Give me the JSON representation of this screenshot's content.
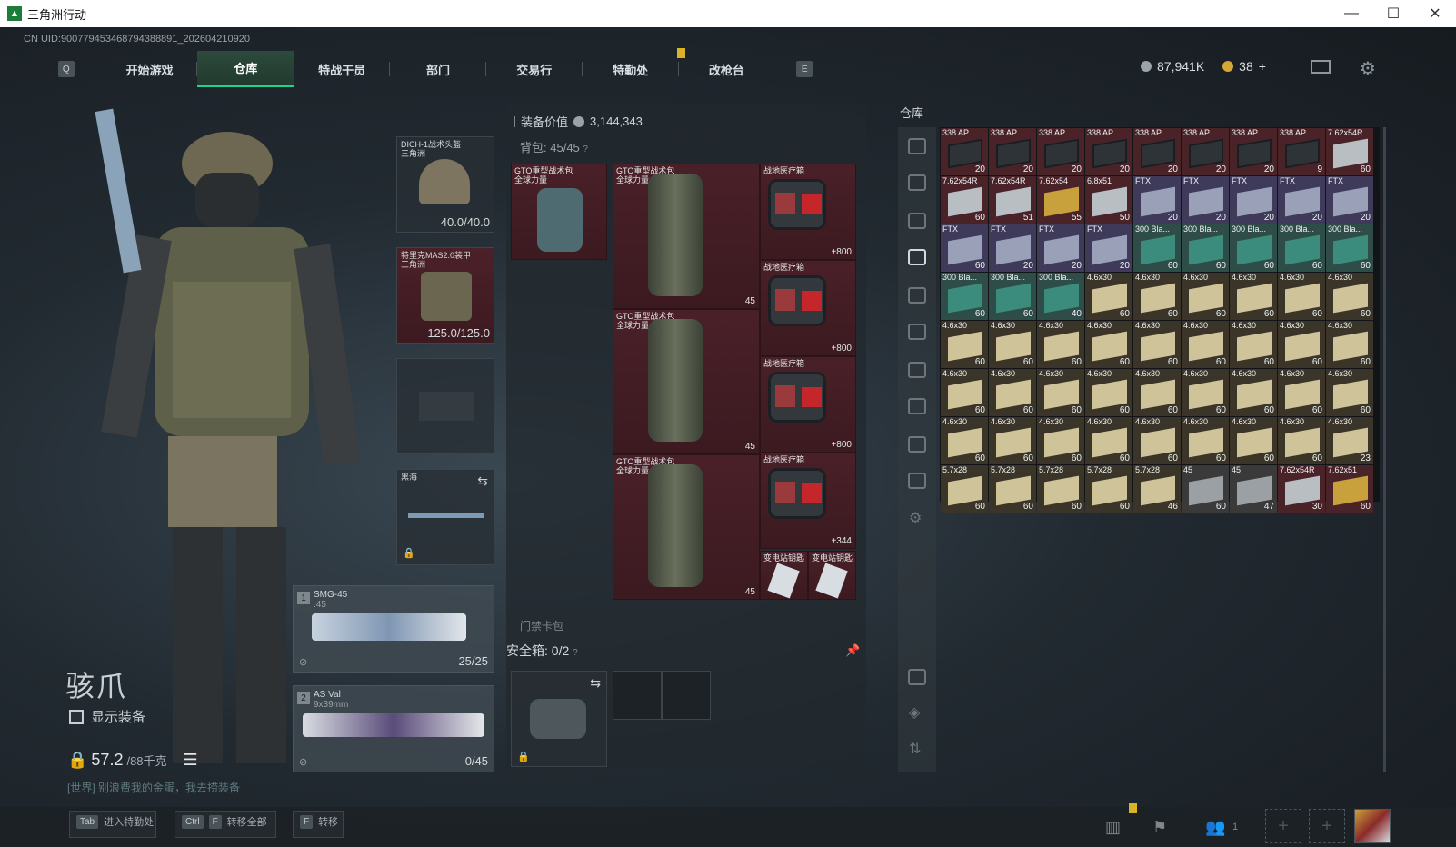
{
  "window": {
    "title": "三角洲行动",
    "minimize": "—",
    "maximize": "☐",
    "close": "✕"
  },
  "uid": "CN UID:900779453468794388891_202604210920",
  "nav": {
    "key_left": "Q",
    "key_right": "E",
    "tabs": [
      "开始游戏",
      "仓库",
      "特战干员",
      "部门",
      "交易行",
      "特勤处",
      "改枪台"
    ],
    "active": "仓库"
  },
  "currency": {
    "primary": "87,941K",
    "secondary": "38",
    "secondary_plus": "+"
  },
  "operator": {
    "name": "骇爪",
    "show_equipment": "显示装备",
    "weight": "57.2",
    "weight_max": "/88千克"
  },
  "chat": "[世界] 别浪费我的金蛋，我去捞装备",
  "slots": {
    "helmet": {
      "name": "DICH-1战术头盔",
      "sub": "三角洲",
      "value": "40.0/40.0"
    },
    "armor": {
      "name": "特里克MAS2.0装甲",
      "sub": "三角洲",
      "value": "125.0/125.0"
    },
    "melee": {
      "name": "黑海"
    }
  },
  "weapons": [
    {
      "index": "1",
      "name": "SMG-45",
      "sub": ".45",
      "ammo": "25/25"
    },
    {
      "index": "2",
      "name": "AS Val",
      "sub": "9x39mm",
      "ammo": "0/45"
    }
  ],
  "middle": {
    "equip_value_label": "装备价值",
    "equip_value": "3,144,343",
    "bag_label": "背包:",
    "bag_value": "45/45",
    "container_label": "门禁卡包",
    "safebox_label": "安全箱:",
    "safebox_value": "0/2",
    "items": [
      {
        "name": "GTO重型战术包",
        "sub": "全球力量"
      },
      {
        "name": "GTO重型战术包",
        "sub": "全球力量",
        "count": "45"
      },
      {
        "name": "GTO重型战术包",
        "sub": "全球力量",
        "count": "45"
      },
      {
        "name": "GTO重型战术包",
        "sub": "全球力量",
        "count": "45"
      },
      {
        "name": "战地医疗箱",
        "count": "+800"
      },
      {
        "name": "战地医疗箱",
        "count": "+800"
      },
      {
        "name": "战地医疗箱",
        "count": "+800"
      },
      {
        "name": "战地医疗箱",
        "count": "+344"
      },
      {
        "name": "变电站钥匙"
      },
      {
        "name": "变电站钥匙"
      }
    ]
  },
  "storage": {
    "title": "仓库",
    "grid": [
      {
        "n": "338 AP",
        "c": "20",
        "t": "338"
      },
      {
        "n": "338 AP",
        "c": "20",
        "t": "338"
      },
      {
        "n": "338 AP",
        "c": "20",
        "t": "338"
      },
      {
        "n": "338 AP",
        "c": "20",
        "t": "338"
      },
      {
        "n": "338 AP",
        "c": "20",
        "t": "338"
      },
      {
        "n": "338 AP",
        "c": "20",
        "t": "338"
      },
      {
        "n": "338 AP",
        "c": "20",
        "t": "338"
      },
      {
        "n": "338 AP",
        "c": "9",
        "t": "338"
      },
      {
        "n": "7.62x54R",
        "c": "60",
        "t": "white"
      },
      {
        "n": "7.62x54R",
        "c": "60",
        "t": "white"
      },
      {
        "n": "7.62x54R",
        "c": "51",
        "t": "white"
      },
      {
        "n": "7.62x54",
        "c": "55",
        "t": "gold"
      },
      {
        "n": "6.8x51",
        "c": "50",
        "t": "white"
      },
      {
        "n": "FTX",
        "c": "20",
        "t": "ftx"
      },
      {
        "n": "FTX",
        "c": "20",
        "t": "ftx"
      },
      {
        "n": "FTX",
        "c": "20",
        "t": "ftx"
      },
      {
        "n": "FTX",
        "c": "20",
        "t": "ftx"
      },
      {
        "n": "FTX",
        "c": "20",
        "t": "ftx"
      },
      {
        "n": "FTX",
        "c": "60",
        "t": "ftx"
      },
      {
        "n": "FTX",
        "c": "20",
        "t": "ftx"
      },
      {
        "n": "FTX",
        "c": "20",
        "t": "ftx"
      },
      {
        "n": "FTX",
        "c": "20",
        "t": "ftx"
      },
      {
        "n": "300 Bla...",
        "c": "60",
        "t": "green"
      },
      {
        "n": "300 Bla...",
        "c": "60",
        "t": "green"
      },
      {
        "n": "300 Bla...",
        "c": "60",
        "t": "green"
      },
      {
        "n": "300 Bla...",
        "c": "60",
        "t": "green"
      },
      {
        "n": "300 Bla...",
        "c": "60",
        "t": "green"
      },
      {
        "n": "300 Bla...",
        "c": "60",
        "t": "green"
      },
      {
        "n": "300 Bla...",
        "c": "60",
        "t": "green"
      },
      {
        "n": "300 Bla...",
        "c": "40",
        "t": "green"
      },
      {
        "n": "4.6x30",
        "c": "60",
        "t": "46"
      },
      {
        "n": "4.6x30",
        "c": "60",
        "t": "46"
      },
      {
        "n": "4.6x30",
        "c": "60",
        "t": "46"
      },
      {
        "n": "4.6x30",
        "c": "60",
        "t": "46"
      },
      {
        "n": "4.6x30",
        "c": "60",
        "t": "46"
      },
      {
        "n": "4.6x30",
        "c": "60",
        "t": "46"
      },
      {
        "n": "4.6x30",
        "c": "60",
        "t": "46"
      },
      {
        "n": "4.6x30",
        "c": "60",
        "t": "46"
      },
      {
        "n": "4.6x30",
        "c": "60",
        "t": "46"
      },
      {
        "n": "4.6x30",
        "c": "60",
        "t": "46"
      },
      {
        "n": "4.6x30",
        "c": "60",
        "t": "46"
      },
      {
        "n": "4.6x30",
        "c": "60",
        "t": "46"
      },
      {
        "n": "4.6x30",
        "c": "60",
        "t": "46"
      },
      {
        "n": "4.6x30",
        "c": "60",
        "t": "46"
      },
      {
        "n": "4.6x30",
        "c": "60",
        "t": "46"
      },
      {
        "n": "4.6x30",
        "c": "60",
        "t": "46"
      },
      {
        "n": "4.6x30",
        "c": "60",
        "t": "46"
      },
      {
        "n": "4.6x30",
        "c": "60",
        "t": "46"
      },
      {
        "n": "4.6x30",
        "c": "60",
        "t": "46"
      },
      {
        "n": "4.6x30",
        "c": "60",
        "t": "46"
      },
      {
        "n": "4.6x30",
        "c": "60",
        "t": "46"
      },
      {
        "n": "4.6x30",
        "c": "60",
        "t": "46"
      },
      {
        "n": "4.6x30",
        "c": "60",
        "t": "46"
      },
      {
        "n": "4.6x30",
        "c": "60",
        "t": "46"
      },
      {
        "n": "4.6x30",
        "c": "60",
        "t": "46"
      },
      {
        "n": "4.6x30",
        "c": "60",
        "t": "46"
      },
      {
        "n": "4.6x30",
        "c": "60",
        "t": "46"
      },
      {
        "n": "4.6x30",
        "c": "60",
        "t": "46"
      },
      {
        "n": "4.6x30",
        "c": "60",
        "t": "46"
      },
      {
        "n": "4.6x30",
        "c": "60",
        "t": "46"
      },
      {
        "n": "4.6x30",
        "c": "60",
        "t": "46"
      },
      {
        "n": "4.6x30",
        "c": "60",
        "t": "46"
      },
      {
        "n": "4.6x30",
        "c": "23",
        "t": "46"
      },
      {
        "n": "5.7x28",
        "c": "60",
        "t": "46"
      },
      {
        "n": "5.7x28",
        "c": "60",
        "t": "46"
      },
      {
        "n": "5.7x28",
        "c": "60",
        "t": "46"
      },
      {
        "n": "5.7x28",
        "c": "60",
        "t": "46"
      },
      {
        "n": "5.7x28",
        "c": "46",
        "t": "46"
      },
      {
        "n": "45",
        "c": "60",
        "t": "grey"
      },
      {
        "n": "45",
        "c": "47",
        "t": "grey"
      },
      {
        "n": "7.62x54R",
        "c": "30",
        "t": "white"
      },
      {
        "n": "7.62x51",
        "c": "60",
        "t": "gold"
      }
    ]
  },
  "bottom": {
    "hints": [
      {
        "key": "Tab",
        "label": "进入特勤处"
      },
      {
        "key": "Ctrl",
        "key2": "F",
        "label": "转移全部"
      },
      {
        "key": "F",
        "label": "转移"
      }
    ],
    "squad_count": "1"
  }
}
